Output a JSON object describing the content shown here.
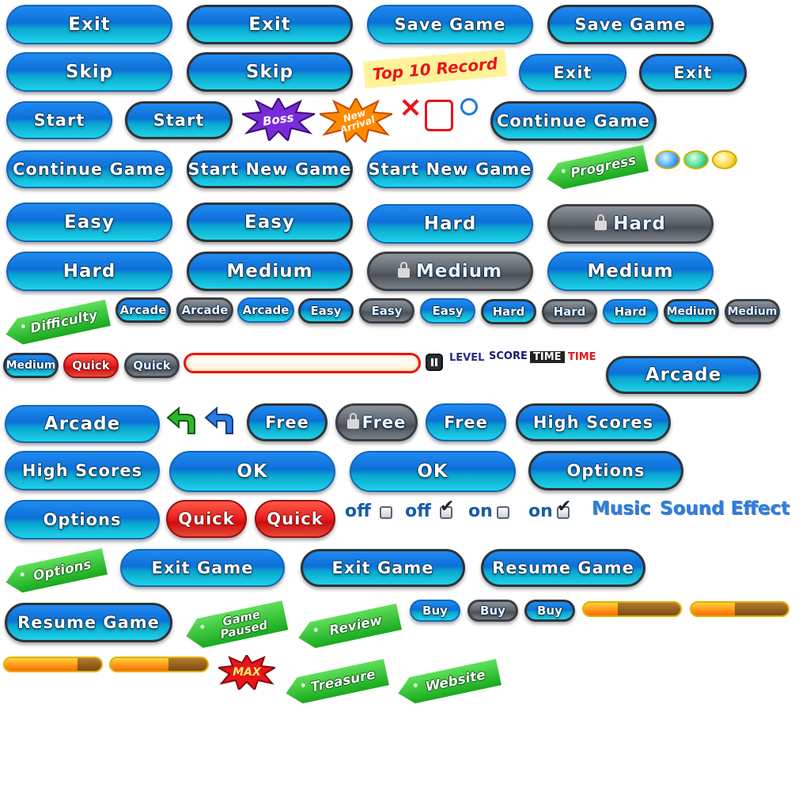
{
  "rows": {
    "r1": [
      "Exit",
      "Exit",
      "Save Game",
      "Save Game"
    ],
    "r2": [
      "Skip",
      "Skip",
      "Exit",
      "Exit"
    ],
    "r2_record": "Top 10 Record",
    "r3": [
      "Start",
      "Start",
      "Continue Game"
    ],
    "r3_burst_boss": "Boss",
    "r3_burst_new": "New Arrival",
    "r3_x": "×",
    "r4": [
      "Continue Game",
      "Start New Game",
      "Start New Game"
    ],
    "r4_tag": "Progress",
    "r5": [
      "Easy",
      "Easy",
      "Hard",
      "Hard"
    ],
    "r6": [
      "Hard",
      "Medium",
      "Medium",
      "Medium"
    ],
    "r7_tag": "Difficulty",
    "r7": [
      "Arcade",
      "Arcade",
      "Arcade",
      "Easy",
      "Easy",
      "Easy",
      "Hard",
      "Hard",
      "Hard",
      "Medium",
      "Medium"
    ],
    "r8": [
      "Medium",
      "Quick",
      "Quick"
    ],
    "r8_labels": {
      "level": "LEVEL",
      "score": "SCORE",
      "time1": "TIME",
      "time2": "TIME"
    },
    "r8_arcade": "Arcade",
    "r9": [
      "Arcade",
      "Free",
      "Free",
      "Free",
      "High Scores"
    ],
    "r10": [
      "High Scores",
      "OK",
      "OK",
      "Options"
    ],
    "r11": [
      "Options",
      "Quick",
      "Quick"
    ],
    "r11_toggles": [
      "off",
      "off",
      "on",
      "on"
    ],
    "r11_music": "Music",
    "r11_sound": "Sound Effect",
    "r12_tag": "Options",
    "r12": [
      "Exit Game",
      "Exit Game",
      "Resume Game"
    ],
    "r13": [
      "Resume Game"
    ],
    "r13_tags": [
      "Game Paused",
      "Review"
    ],
    "r13_buy": [
      "Buy",
      "Buy",
      "Buy"
    ],
    "r14_max": "MAX",
    "r14_tags": [
      "Treasure",
      "Website"
    ]
  },
  "progress_bars": [
    0.35,
    0.45,
    0.75,
    0.6
  ],
  "colors": {
    "blue": "#0d6fd8",
    "cyan": "#1ed3e8",
    "gray": "#5b6167",
    "red": "#e81c1c",
    "green": "#18a81e",
    "label_blue": "#1a5ca8"
  }
}
